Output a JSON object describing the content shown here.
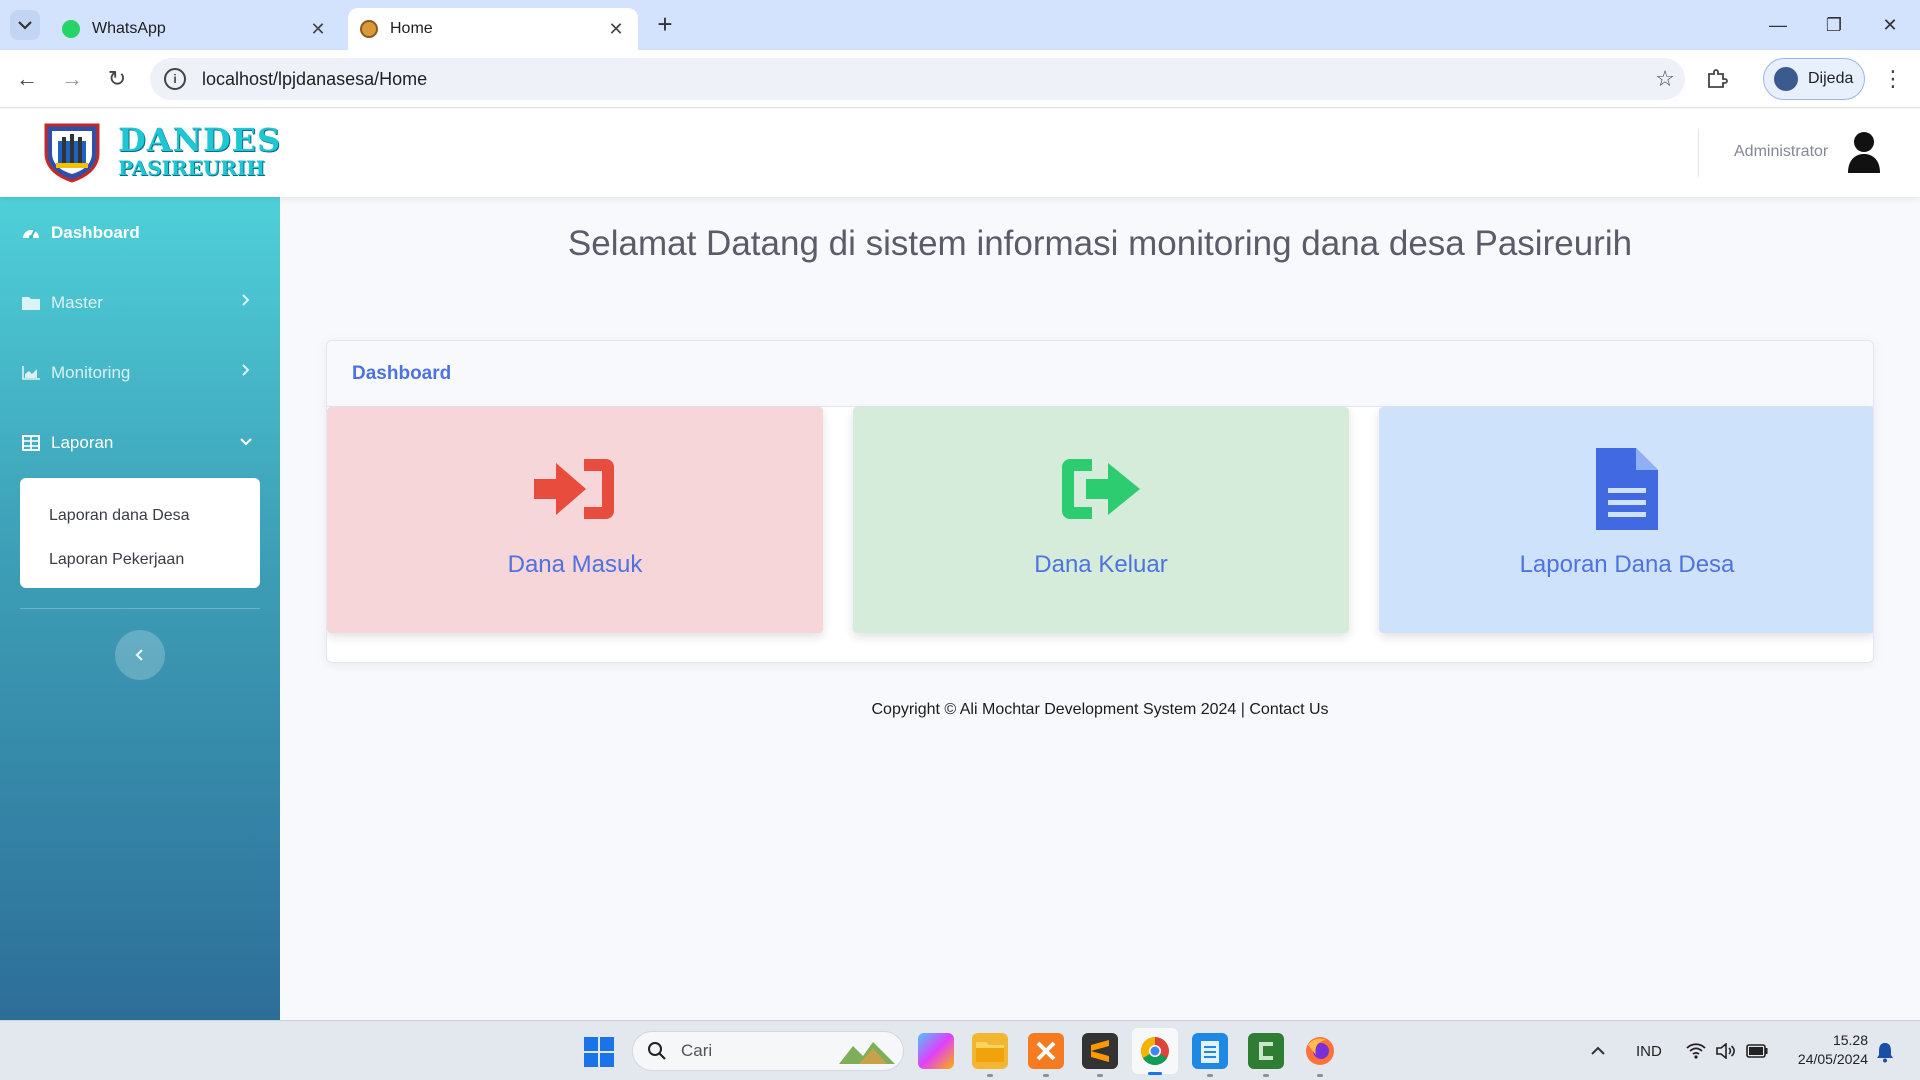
{
  "browser": {
    "tabs": [
      {
        "title": "WhatsApp",
        "active": false
      },
      {
        "title": "Home",
        "active": true
      }
    ],
    "url": "localhost/lpjdanasesa/Home",
    "profile_name": "Dijeda"
  },
  "header": {
    "logo_line1": "DANDES",
    "logo_line2": "PASIREURIH",
    "user_name": "Administrator"
  },
  "sidebar": {
    "items": [
      {
        "label": "Dashboard",
        "icon": "tachometer-icon"
      },
      {
        "label": "Master",
        "icon": "folder-icon"
      },
      {
        "label": "Monitoring",
        "icon": "area-chart-icon"
      },
      {
        "label": "Laporan",
        "icon": "table-icon"
      }
    ],
    "laporan_submenu": [
      "Laporan dana Desa",
      "Laporan Pekerjaan"
    ]
  },
  "main": {
    "welcome": "Selamat Datang di sistem informasi monitoring dana desa Pasireurih",
    "card_title": "Dashboard",
    "tiles": [
      {
        "label": "Dana Masuk",
        "icon": "sign-in-icon",
        "color": "#e74c3c",
        "bg": "#f6d6d8"
      },
      {
        "label": "Dana Keluar",
        "icon": "sign-out-icon",
        "color": "#2ecc71",
        "bg": "#d5ecdb"
      },
      {
        "label": "Laporan Dana Desa",
        "icon": "file-text-icon",
        "color": "#4169e1",
        "bg": "#cfe2fb"
      }
    ],
    "footer_text": "Copyright © Ali Mochtar Development System 2024 | ",
    "footer_link": "Contact Us"
  },
  "taskbar": {
    "search_placeholder": "Cari",
    "language": "IND",
    "time": "15.28",
    "date": "24/05/2024"
  },
  "colors": {
    "accent": "#4e73df",
    "sidebar_top": "#4fd0d9",
    "sidebar_bottom": "#2d6e98"
  }
}
